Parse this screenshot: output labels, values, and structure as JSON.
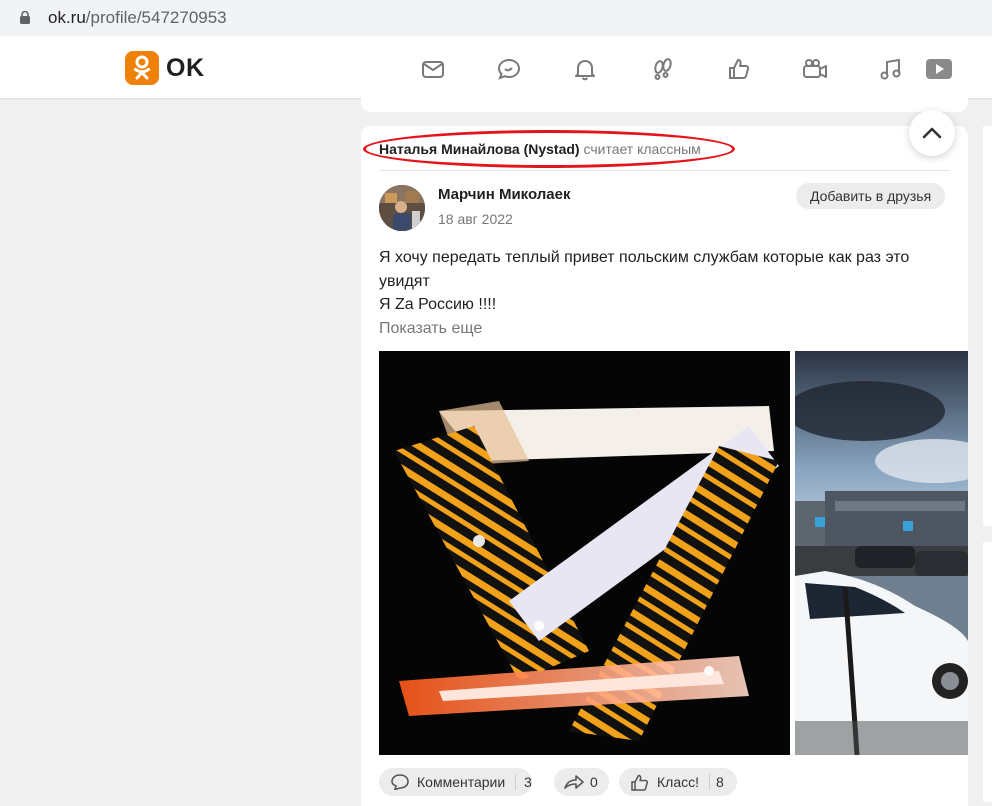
{
  "browser": {
    "url_host": "ok.ru",
    "url_path": "/profile/547270953"
  },
  "header": {
    "logo_text": "OK",
    "nav": [
      {
        "name": "messages-icon"
      },
      {
        "name": "discussions-icon"
      },
      {
        "name": "notifications-icon"
      },
      {
        "name": "guests-icon"
      },
      {
        "name": "likes-icon"
      },
      {
        "name": "video-icon"
      },
      {
        "name": "music-icon"
      },
      {
        "name": "play-icon"
      }
    ],
    "accent_color": "#ee8208"
  },
  "feed": {
    "activity": {
      "who": "Наталья Минайлова (Nystad)",
      "action": "считает классным"
    },
    "post": {
      "author": "Марчин Миколаек",
      "date": "18 авг 2022",
      "add_friend_label": "Добавить в друзья",
      "text_line1": "Я хочу передать теплый привет польским службам которые как раз это увидят",
      "text_line2": "Я Za Россию !!!!",
      "show_more": "Показать еще",
      "actions": {
        "comments_label": "Комментарии",
        "comments_count": "3",
        "shares_count": "0",
        "likes_label": "Класс!",
        "likes_count": "8"
      }
    },
    "highlight_color": "#e4141b"
  }
}
